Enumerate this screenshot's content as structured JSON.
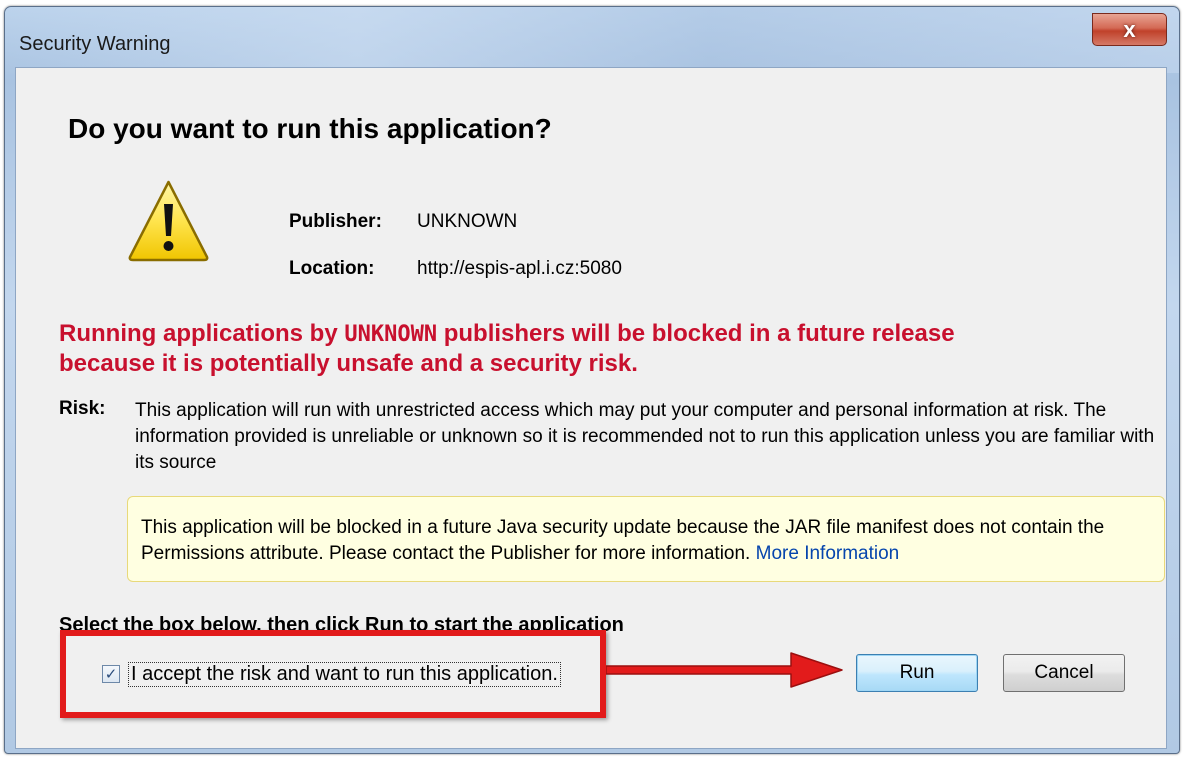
{
  "window": {
    "title": "Security Warning",
    "close_label": "x"
  },
  "dialog": {
    "heading": "Do you want to run this application?",
    "publisher_label": "Publisher:",
    "publisher_value": "UNKNOWN",
    "location_label": "Location:",
    "location_value": "http://espis-apl.i.cz:5080",
    "warning_line1_pre": "Running applications by ",
    "warning_line1_mono": "UNKNOWN",
    "warning_line1_post": " publishers will be blocked in a future release",
    "warning_line2": "because it is potentially unsafe and a security risk.",
    "risk_label": "Risk:",
    "risk_text": "This application will run with unrestricted access which may put your computer and personal information at risk. The information provided is unreliable or unknown so it is recommended not to run this application unless you are familiar with its source",
    "info_text": "This application will be blocked in a future Java security update because the JAR file manifest does not contain the Permissions attribute. Please contact the Publisher for more information.",
    "info_link": "More Information",
    "select_label": "Select the box below, then click Run to start the application",
    "checkbox_checked": true,
    "checkbox_mark": "✓",
    "accept_label": "I accept the risk and want to run this application.",
    "run_label": "Run",
    "cancel_label": "Cancel"
  },
  "colors": {
    "warning_red": "#c8102e",
    "annotation_red": "#e21b1b",
    "link_blue": "#0645ad",
    "info_bg": "#ffffe1"
  },
  "icons": {
    "warning": "warning-triangle-icon",
    "close": "close-icon",
    "annotation_arrow": "arrow-right-icon"
  }
}
